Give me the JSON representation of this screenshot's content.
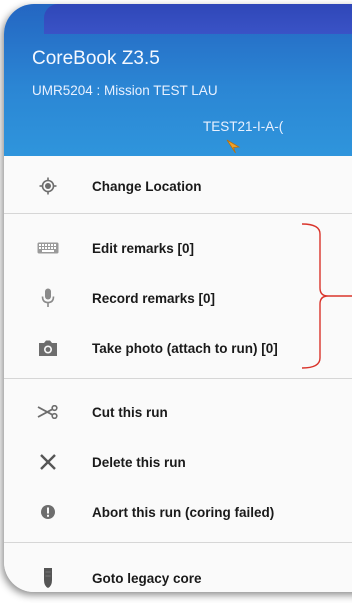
{
  "header": {
    "app_title": "CoreBook Z3.5",
    "mission": "UMR5204 : Mission TEST LAU",
    "run_id": "TEST21-I-A-("
  },
  "menu": {
    "items": [
      {
        "label": "Change Location",
        "icon": "location-target-icon"
      },
      {
        "label": "Edit remarks [0]",
        "icon": "keyboard-icon"
      },
      {
        "label": "Record remarks [0]",
        "icon": "microphone-icon"
      },
      {
        "label": "Take photo (attach to run) [0]",
        "icon": "camera-icon"
      },
      {
        "label": "Cut this run",
        "icon": "scissors-icon"
      },
      {
        "label": "Delete this run",
        "icon": "close-icon"
      },
      {
        "label": "Abort this run (coring failed)",
        "icon": "alert-circle-icon"
      },
      {
        "label": "Goto legacy core",
        "icon": "core-sample-icon"
      }
    ]
  },
  "colors": {
    "header_top": "#2466c2",
    "header_bottom": "#2f95dc",
    "annotation": "#d9342b",
    "icon_gray": "#6d6d6d"
  }
}
